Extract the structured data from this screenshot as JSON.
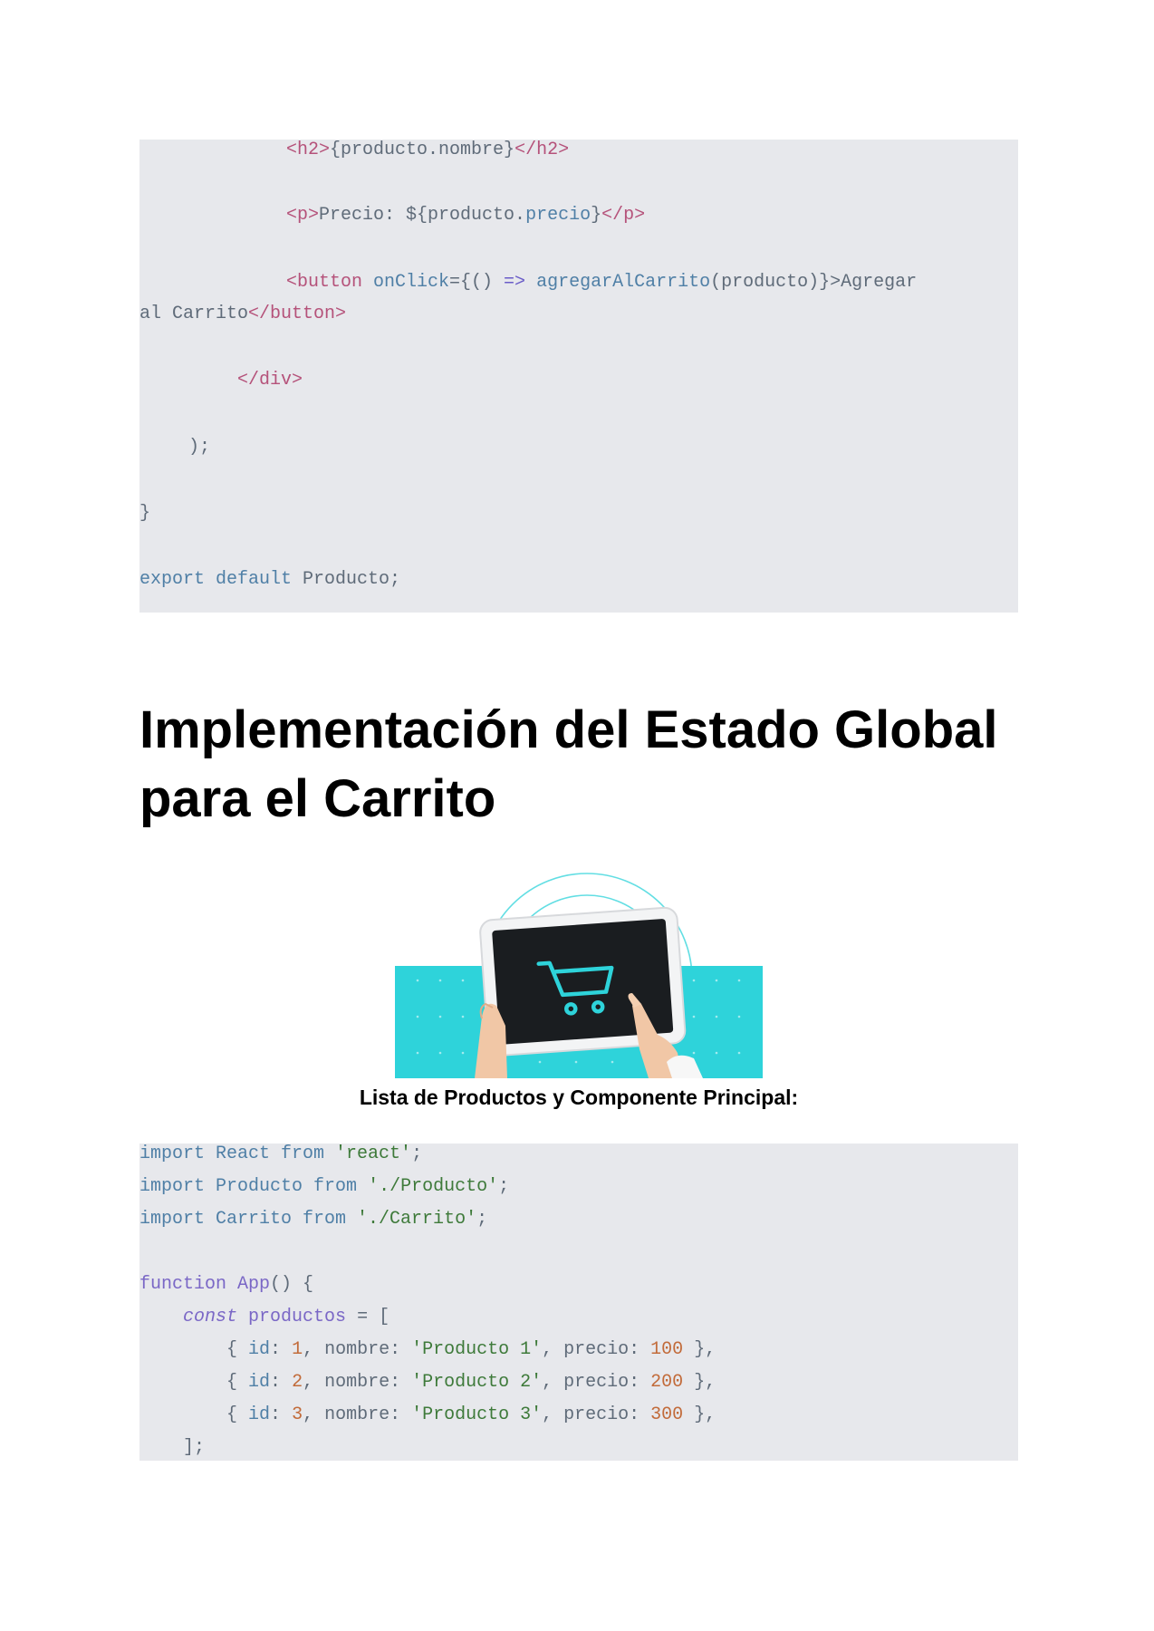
{
  "code_block_1": {
    "lines": [
      {
        "segments": [
          {
            "t": "<h2>",
            "c": "tag"
          },
          {
            "t": "{producto.nombre}",
            "c": "pl"
          },
          {
            "t": "</h2>",
            "c": "tag"
          }
        ]
      },
      {
        "segments": [
          {
            "t": "<p>",
            "c": "tag"
          },
          {
            "t": "Precio: ${producto.",
            "c": "pl"
          },
          {
            "t": "precio",
            "c": "kw"
          },
          {
            "t": "}",
            "c": "pl"
          },
          {
            "t": "</p>",
            "c": "tag"
          }
        ]
      },
      {
        "segments": [
          {
            "t": "<button ",
            "c": "tag"
          },
          {
            "t": "onClick",
            "c": "kw"
          },
          {
            "t": "={() ",
            "c": "pl"
          },
          {
            "t": "=>",
            "c": "attr"
          },
          {
            "t": " ",
            "c": "pl"
          },
          {
            "t": "agregarAlCarrito",
            "c": "kw"
          },
          {
            "t": "(producto)}>Agregar",
            "c": "pl"
          }
        ]
      },
      {
        "segments": [
          {
            "t": "al Carrito",
            "c": "pl"
          },
          {
            "t": "</button>",
            "c": "tag"
          }
        ]
      },
      {
        "segments": [
          {
            "t": "</div>",
            "c": "tag"
          }
        ]
      },
      {
        "segments": [
          {
            "t": ");",
            "c": "pl"
          }
        ]
      },
      {
        "segments": [
          {
            "t": "}",
            "c": "pl"
          }
        ]
      },
      {
        "segments": [
          {
            "t": "export default ",
            "c": "kw"
          },
          {
            "t": "Producto;",
            "c": "pl"
          }
        ]
      }
    ]
  },
  "heading": {
    "line1": "Implementación del Estado Global",
    "line2": "para el Carrito"
  },
  "illustration": {
    "icon": "shopping-cart-icon",
    "accent_color": "#2ed3da",
    "screen_color": "#1a1d20"
  },
  "caption": "Lista de Productos y Componente Principal:",
  "code_block_2": {
    "lines": [
      {
        "segments": [
          {
            "t": "import ",
            "c": "kw"
          },
          {
            "t": "React ",
            "c": "kw"
          },
          {
            "t": "from ",
            "c": "kw"
          },
          {
            "t": "'react'",
            "c": "str"
          },
          {
            "t": ";",
            "c": "pl"
          }
        ]
      },
      {
        "segments": [
          {
            "t": "import ",
            "c": "kw"
          },
          {
            "t": "Producto ",
            "c": "kw"
          },
          {
            "t": "from ",
            "c": "kw"
          },
          {
            "t": "'./Producto'",
            "c": "str"
          },
          {
            "t": ";",
            "c": "pl"
          }
        ]
      },
      {
        "segments": [
          {
            "t": "import ",
            "c": "kw"
          },
          {
            "t": "Carrito ",
            "c": "kw"
          },
          {
            "t": "from ",
            "c": "kw"
          },
          {
            "t": "'./Carrito'",
            "c": "str"
          },
          {
            "t": ";",
            "c": "pl"
          }
        ]
      },
      {
        "segments": []
      },
      {
        "segments": [
          {
            "t": "function ",
            "c": "fn"
          },
          {
            "t": "App",
            "c": "fn"
          },
          {
            "t": "() {",
            "c": "pl"
          }
        ]
      },
      {
        "segments": [
          {
            "t": "    ",
            "c": "pl"
          },
          {
            "t": "const ",
            "c": "it"
          },
          {
            "t": "productos ",
            "c": "fn"
          },
          {
            "t": "= [",
            "c": "pl"
          }
        ]
      },
      {
        "segments": [
          {
            "t": "        { ",
            "c": "pl"
          },
          {
            "t": "id",
            "c": "kw"
          },
          {
            "t": ": ",
            "c": "pl"
          },
          {
            "t": "1",
            "c": "num"
          },
          {
            "t": ", nombre: ",
            "c": "pl"
          },
          {
            "t": "'Producto 1'",
            "c": "str"
          },
          {
            "t": ", precio: ",
            "c": "pl"
          },
          {
            "t": "100",
            "c": "num"
          },
          {
            "t": " },",
            "c": "pl"
          }
        ]
      },
      {
        "segments": [
          {
            "t": "        { ",
            "c": "pl"
          },
          {
            "t": "id",
            "c": "kw"
          },
          {
            "t": ": ",
            "c": "pl"
          },
          {
            "t": "2",
            "c": "num"
          },
          {
            "t": ", nombre: ",
            "c": "pl"
          },
          {
            "t": "'Producto 2'",
            "c": "str"
          },
          {
            "t": ", precio: ",
            "c": "pl"
          },
          {
            "t": "200",
            "c": "num"
          },
          {
            "t": " },",
            "c": "pl"
          }
        ]
      },
      {
        "segments": [
          {
            "t": "        { ",
            "c": "pl"
          },
          {
            "t": "id",
            "c": "kw"
          },
          {
            "t": ": ",
            "c": "pl"
          },
          {
            "t": "3",
            "c": "num"
          },
          {
            "t": ", nombre: ",
            "c": "pl"
          },
          {
            "t": "'Producto 3'",
            "c": "str"
          },
          {
            "t": ", precio: ",
            "c": "pl"
          },
          {
            "t": "300",
            "c": "num"
          },
          {
            "t": " },",
            "c": "pl"
          }
        ]
      },
      {
        "segments": [
          {
            "t": "    ];",
            "c": "pl"
          }
        ]
      }
    ]
  }
}
